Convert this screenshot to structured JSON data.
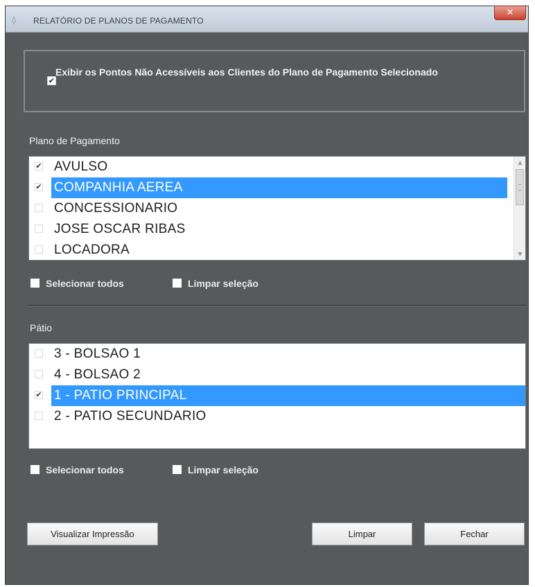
{
  "window": {
    "title": "RELATÓRIO DE PLANOS DE PAGAMENTO",
    "close_glyph": "✕",
    "app_icon": "app-icon"
  },
  "option": {
    "checked": true,
    "label": "Exibir os Pontos Não Acessíveis aos Clientes do Plano de Pagamento Selecionado",
    "check_glyph": "✔"
  },
  "plano": {
    "label": "Plano de Pagamento",
    "items": [
      {
        "text": "AVULSO",
        "checked": true,
        "selected": false,
        "glyph": "✔"
      },
      {
        "text": "COMPANHIA AEREA",
        "checked": true,
        "selected": true,
        "glyph": "✔"
      },
      {
        "text": "CONCESSIONARIO",
        "checked": false,
        "selected": false,
        "glyph": ""
      },
      {
        "text": "JOSE OSCAR RIBAS",
        "checked": false,
        "selected": false,
        "glyph": ""
      },
      {
        "text": "LOCADORA",
        "checked": false,
        "selected": false,
        "glyph": ""
      }
    ],
    "select_all": "Selecionar todos",
    "clear_selection": "Limpar seleção",
    "scroll_up": "▲",
    "scroll_down": "▼"
  },
  "patio": {
    "label": "Pátio",
    "items": [
      {
        "text": "3 - BOLSAO 1",
        "checked": false,
        "selected": false,
        "glyph": ""
      },
      {
        "text": "4 - BOLSAO 2",
        "checked": false,
        "selected": false,
        "glyph": ""
      },
      {
        "text": "1 - PATIO PRINCIPAL",
        "checked": true,
        "selected": true,
        "glyph": "✔"
      },
      {
        "text": "2 - PATIO SECUNDARIO",
        "checked": false,
        "selected": false,
        "glyph": ""
      }
    ],
    "select_all": "Selecionar todos",
    "clear_selection": "Limpar seleção"
  },
  "buttons": {
    "preview": "Visualizar Impressão",
    "clear": "Limpar",
    "close": "Fechar"
  },
  "colors": {
    "background": "#58595a",
    "selection": "#3399ff",
    "titlebar": "#c9d4df",
    "close": "#c9432e"
  }
}
